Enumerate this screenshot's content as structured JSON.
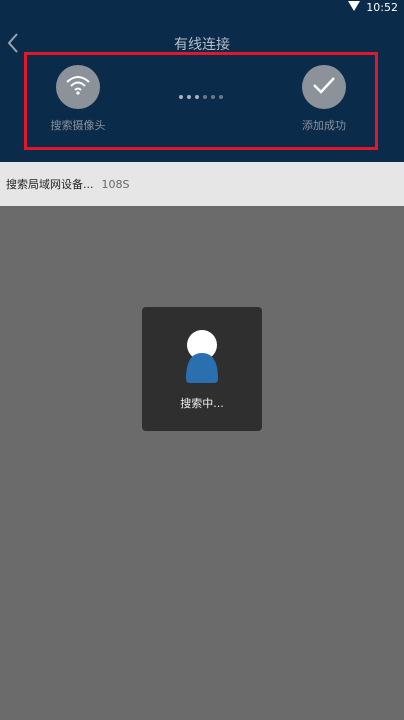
{
  "status_bar": {
    "time": "10:52",
    "wifi_icon": "wifi-strength-icon"
  },
  "header": {
    "title": "有线连接",
    "back_icon": "chevron-left-icon",
    "steps": [
      {
        "label": "搜索摄像头",
        "icon": "wifi-icon"
      },
      {
        "label": "添加成功",
        "icon": "check-icon"
      }
    ],
    "progress": {
      "dots_total": 6,
      "dots_active": 3
    }
  },
  "search_status": {
    "text": "搜索局域网设备...",
    "timer": "108S"
  },
  "toast": {
    "text": "搜索中...",
    "icon": "person-search-icon"
  },
  "colors": {
    "header_bg": "#0b2b4a",
    "highlight_border": "#e1172a",
    "overlay": "#6b6b6b",
    "toast_bg": "#2f2f2f",
    "toast_icon": "#2a6fb0"
  }
}
